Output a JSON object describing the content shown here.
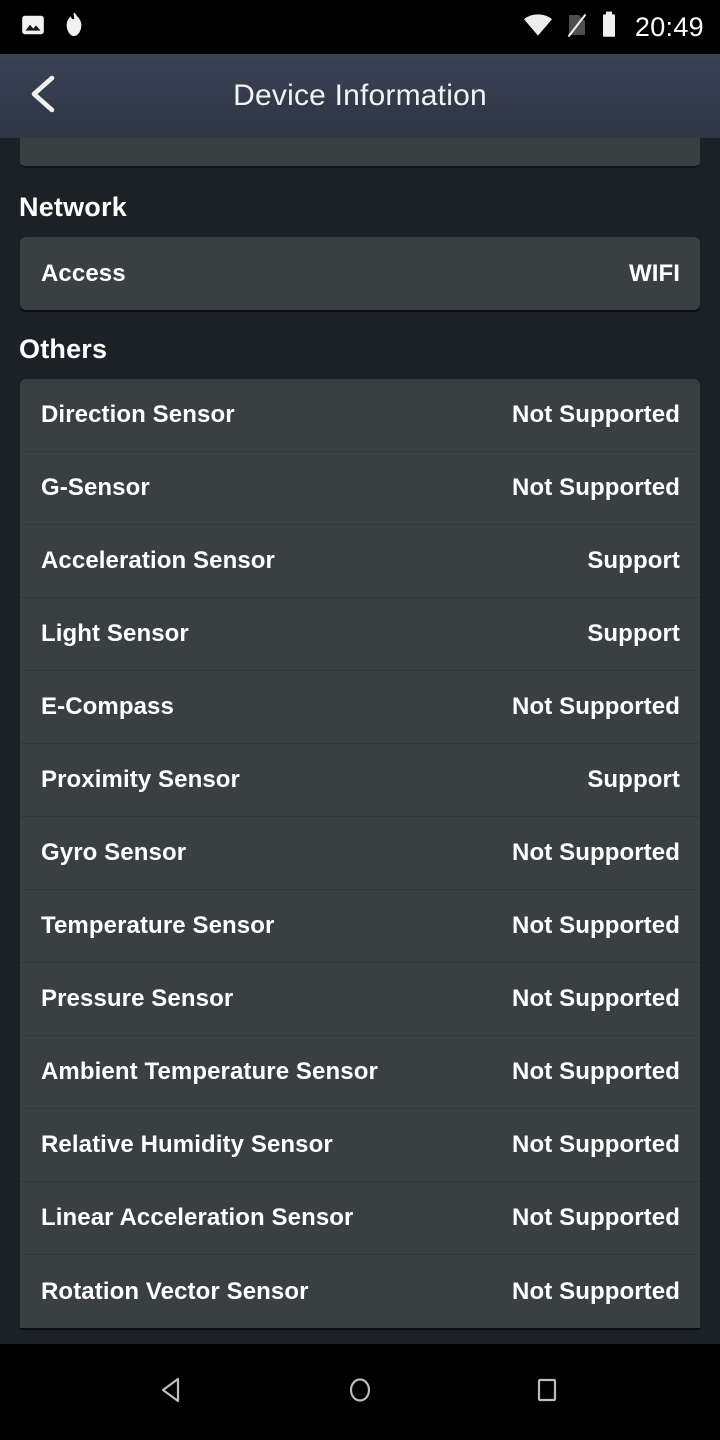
{
  "status_bar": {
    "left_icons": [
      {
        "name": "image-icon",
        "label": "Screenshot"
      },
      {
        "name": "flame-icon",
        "label": "Notification"
      }
    ],
    "right_icons": [
      {
        "name": "wifi-icon",
        "label": "WiFi"
      },
      {
        "name": "no-sim-icon",
        "label": "No SIM"
      },
      {
        "name": "battery-icon",
        "label": "Battery"
      }
    ],
    "clock": "20:49"
  },
  "app_bar": {
    "back_label": "Back",
    "title": "Device Information"
  },
  "sections": [
    {
      "title": "Network",
      "rows": [
        {
          "label": "Access",
          "value": "WIFI"
        }
      ]
    },
    {
      "title": "Others",
      "rows": [
        {
          "label": "Direction Sensor",
          "value": "Not Supported"
        },
        {
          "label": "G-Sensor",
          "value": "Not Supported"
        },
        {
          "label": "Acceleration Sensor",
          "value": "Support"
        },
        {
          "label": "Light Sensor",
          "value": "Support"
        },
        {
          "label": "E-Compass",
          "value": "Not Supported"
        },
        {
          "label": "Proximity Sensor",
          "value": "Support"
        },
        {
          "label": "Gyro Sensor",
          "value": "Not Supported"
        },
        {
          "label": "Temperature Sensor",
          "value": "Not Supported"
        },
        {
          "label": "Pressure Sensor",
          "value": "Not Supported"
        },
        {
          "label": "Ambient Temperature Sensor",
          "value": "Not Supported"
        },
        {
          "label": "Relative Humidity Sensor",
          "value": "Not Supported"
        },
        {
          "label": "Linear Acceleration Sensor",
          "value": "Not Supported"
        },
        {
          "label": "Rotation Vector Sensor",
          "value": "Not Supported"
        }
      ]
    }
  ],
  "nav_bar": {
    "buttons": [
      {
        "name": "back-nav-button",
        "label": "Back"
      },
      {
        "name": "home-nav-button",
        "label": "Home"
      },
      {
        "name": "recents-nav-button",
        "label": "Recents"
      }
    ]
  },
  "colors": {
    "page_background": "#1c2128",
    "app_bar": "#343d4e",
    "card": "#3a3f42",
    "divider": "#32373a",
    "text": "#ffffff",
    "status_bar": "#000000"
  }
}
